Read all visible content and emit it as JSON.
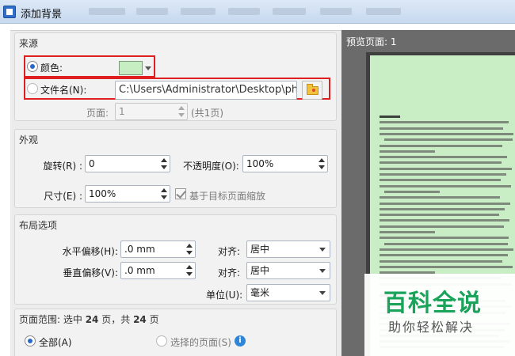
{
  "window": {
    "title": "添加背景"
  },
  "source": {
    "section_title": "来源",
    "color_label": "颜色:",
    "color_value": "#c7eec3",
    "file_label": "文件名(N):",
    "file_path": "C:\\Users\\Administrator\\Desktop\\photo",
    "page_label": "页面:",
    "page_value": "1",
    "page_total": "(共1页)"
  },
  "appearance": {
    "section_title": "外观",
    "rotation_label": "旋转(R) :",
    "rotation_value": "0",
    "opacity_label": "不透明度(O):",
    "opacity_value": "100%",
    "size_label": "尺寸(E) :",
    "size_value": "100%",
    "scale_checkbox_label": "基于目标页面缩放"
  },
  "layout": {
    "section_title": "布局选项",
    "h_offset_label": "水平偏移(H):",
    "h_offset_value": ".0 mm",
    "v_offset_label": "垂直偏移(V):",
    "v_offset_value": ".0 mm",
    "align_label_1": "对齐:",
    "align_value_1": "居中",
    "align_label_2": "对齐:",
    "align_value_2": "居中",
    "unit_label": "单位(U):",
    "unit_value": "毫米"
  },
  "page_range": {
    "section_title_prefix": "页面范围: 选中",
    "selected_count": "24",
    "section_title_mid": "页，共",
    "total_count": "24",
    "section_title_suffix": "页",
    "all_label": "全部(A)",
    "selected_label": "选择的页面(S)",
    "info_icon_char": "i"
  },
  "preview": {
    "title": "预览页面: 1"
  },
  "watermark": {
    "main": "百科全说",
    "sub": "助你轻松解决"
  },
  "colors": {
    "highlight_border": "#e02020",
    "preview_page_bg": "#c9eec6",
    "watermark_green": "#1aa35a"
  }
}
